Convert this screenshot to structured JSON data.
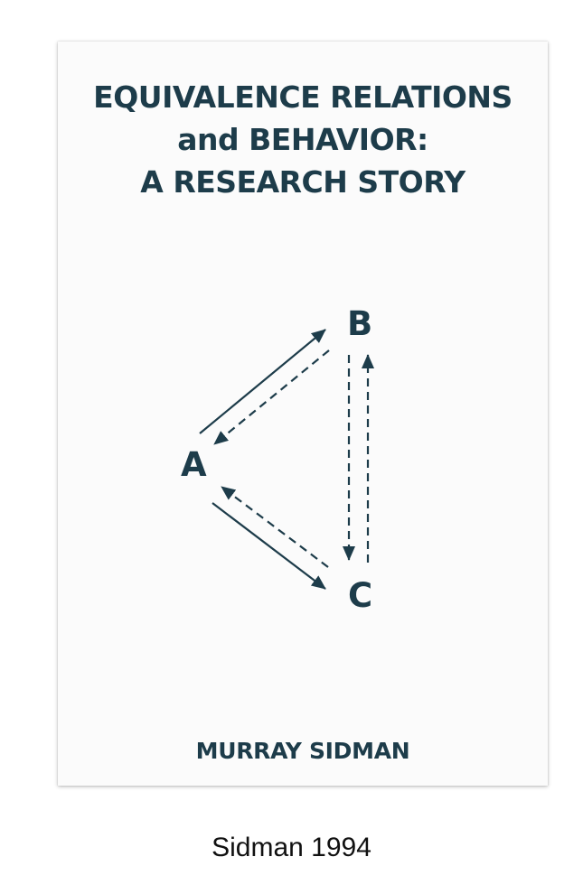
{
  "cover": {
    "title_lines": [
      "EQUIVALENCE RELATIONS",
      "and BEHAVIOR:",
      "A RESEARCH STORY"
    ],
    "author": "MURRAY SIDMAN",
    "ink_color": "#1d3c4a"
  },
  "diagram": {
    "nodes": [
      {
        "id": "A",
        "label": "A"
      },
      {
        "id": "B",
        "label": "B"
      },
      {
        "id": "C",
        "label": "C"
      }
    ],
    "relations": [
      {
        "from": "A",
        "to": "B",
        "style": "solid"
      },
      {
        "from": "B",
        "to": "A",
        "style": "dashed"
      },
      {
        "from": "A",
        "to": "C",
        "style": "solid"
      },
      {
        "from": "C",
        "to": "A",
        "style": "dashed"
      },
      {
        "from": "B",
        "to": "C",
        "style": "dashed"
      },
      {
        "from": "C",
        "to": "B",
        "style": "dashed"
      }
    ]
  },
  "caption": "Sidman 1994"
}
